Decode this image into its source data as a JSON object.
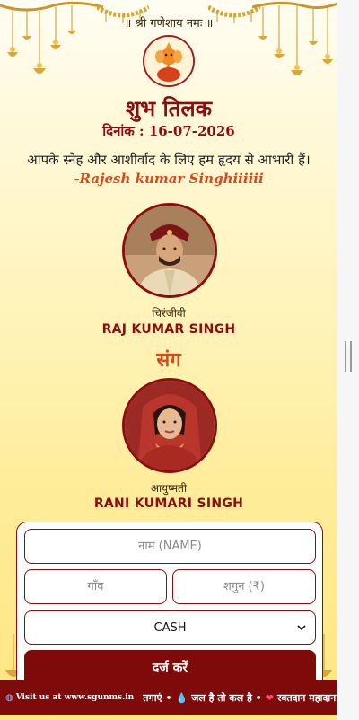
{
  "invitation": {
    "invocation": "॥ श्री गणेशाय नमः ॥",
    "title": "शुभ तिलक",
    "date": "दिनांक : 16-07-2026",
    "thanks_message": "आपके स्नेह और आशीर्वाद के लिए हम हृदय से आभारी हैं।",
    "sender": "-Rajesh kumar Singhiiiiii"
  },
  "groom": {
    "relation": "चिरंजीवी",
    "name": "RAJ KUMAR SINGH"
  },
  "with_label": "संग",
  "bride": {
    "relation": "आयुष्मती",
    "name": "RANI KUMARI SINGH"
  },
  "form": {
    "name_placeholder": "नाम (NAME)",
    "village_placeholder": "गाँव",
    "amount_placeholder": "शगुन (₹)",
    "payment_selected": "CASH",
    "submit_label": "दर्ज करें"
  },
  "ticker": {
    "site": "Visit us at www.sgunms.in",
    "item1": "तगाएं •",
    "item2": "जल है तो कल है •",
    "item3": "रक्तदान महादान"
  },
  "colors": {
    "accent": "#8b0d0d",
    "highlight": "#d84a1b",
    "background_top": "#fffdf3",
    "background_bottom": "#ffe682"
  }
}
